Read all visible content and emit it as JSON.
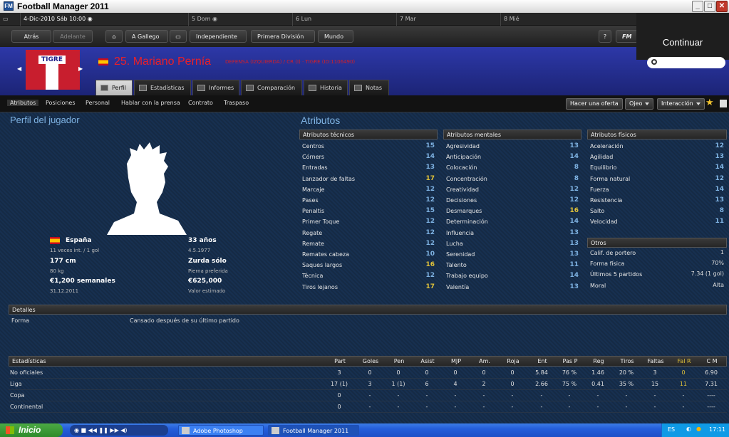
{
  "window": {
    "title": "Football Manager 2011",
    "icon_label": "FM"
  },
  "datebar": {
    "current": "4-Dic-2010 Sáb 10:00",
    "days": [
      "5 Dom",
      "6 Lun",
      "7 Mar",
      "8 Mié"
    ]
  },
  "nav": {
    "back": "Atrás",
    "forward": "Adelante",
    "club_menu": "A Gallego",
    "status_menu": "Independiente",
    "league_menu": "Primera División",
    "world_menu": "Mundo",
    "help": "?",
    "fm_menu": "FM",
    "continue": "Continuar"
  },
  "player": {
    "club_badge": "TIGRE",
    "name": "25. Mariano Pernía",
    "info": "DEFENSA (IZQUIERDA) / CR (I) · TIGRE (ID:1106490)",
    "nationality": "España",
    "caps": "11 veces int. / 1 gol",
    "age": "33 años",
    "dob": "4.5.1977",
    "height": "177 cm",
    "foot": "Zurda sólo",
    "weight": "80 kg",
    "foot_label": "Pierna preferida",
    "wage": "€1,200 semanales",
    "value": "€625,000",
    "contract_end": "31.12.2011",
    "value_label": "Valor estimado"
  },
  "tabs": [
    "Perfil",
    "Estadísticas",
    "Informes",
    "Comparación",
    "Historia",
    "Notas"
  ],
  "subtabs": [
    "Atributos",
    "Posiciones",
    "Personal",
    "Hablar con la prensa",
    "Contrato",
    "Traspaso"
  ],
  "actions": {
    "offer": "Hacer una oferta",
    "scout": "Ojeo",
    "interact": "Interacción"
  },
  "sections": {
    "profile": "Perfil del jugador",
    "attributes": "Atributos"
  },
  "technical": {
    "title": "Atributos técnicos",
    "items": [
      {
        "label": "Centros",
        "value": "15"
      },
      {
        "label": "Córners",
        "value": "14"
      },
      {
        "label": "Entradas",
        "value": "13"
      },
      {
        "label": "Lanzador de faltas",
        "value": "17"
      },
      {
        "label": "Marcaje",
        "value": "12"
      },
      {
        "label": "Pases",
        "value": "12"
      },
      {
        "label": "Penaltis",
        "value": "15"
      },
      {
        "label": "Primer Toque",
        "value": "12"
      },
      {
        "label": "Regate",
        "value": "12"
      },
      {
        "label": "Remate",
        "value": "12"
      },
      {
        "label": "Remates cabeza",
        "value": "10"
      },
      {
        "label": "Saques largos",
        "value": "16"
      },
      {
        "label": "Técnica",
        "value": "12"
      },
      {
        "label": "Tiros lejanos",
        "value": "17"
      }
    ]
  },
  "mental": {
    "title": "Atributos mentales",
    "items": [
      {
        "label": "Agresividad",
        "value": "13"
      },
      {
        "label": "Anticipación",
        "value": "14"
      },
      {
        "label": "Colocación",
        "value": "8"
      },
      {
        "label": "Concentración",
        "value": "8"
      },
      {
        "label": "Creatividad",
        "value": "12"
      },
      {
        "label": "Decisiones",
        "value": "12"
      },
      {
        "label": "Desmarques",
        "value": "16"
      },
      {
        "label": "Determinación",
        "value": "14"
      },
      {
        "label": "Influencia",
        "value": "13"
      },
      {
        "label": "Lucha",
        "value": "13"
      },
      {
        "label": "Serenidad",
        "value": "13"
      },
      {
        "label": "Talento",
        "value": "11"
      },
      {
        "label": "Trabajo equipo",
        "value": "14"
      },
      {
        "label": "Valentía",
        "value": "13"
      }
    ]
  },
  "physical": {
    "title": "Atributos físicos",
    "items": [
      {
        "label": "Aceleración",
        "value": "12"
      },
      {
        "label": "Agilidad",
        "value": "13"
      },
      {
        "label": "Equilibrio",
        "value": "14"
      },
      {
        "label": "Forma natural",
        "value": "12"
      },
      {
        "label": "Fuerza",
        "value": "14"
      },
      {
        "label": "Resistencia",
        "value": "13"
      },
      {
        "label": "Salto",
        "value": "8"
      },
      {
        "label": "Velocidad",
        "value": "11"
      }
    ]
  },
  "others": {
    "title": "Otros",
    "items": [
      {
        "label": "Calif. de portero",
        "value": "1"
      },
      {
        "label": "Forma física",
        "value": "70%"
      },
      {
        "label": "Últimos 5 partidos",
        "value": "7.34 (1 gol)"
      },
      {
        "label": "Moral",
        "value": "Alta"
      }
    ]
  },
  "details": {
    "title": "Detalles",
    "label": "Forma",
    "value": "Cansado después de su último partido"
  },
  "stats": {
    "title": "Estadísticas",
    "columns": [
      "Part",
      "Goles",
      "Pen",
      "Asist",
      "MJP",
      "Am.",
      "Roja",
      "Ent",
      "Pas P",
      "Reg",
      "Tiros",
      "Faltas",
      "Fal R",
      "C M"
    ],
    "rows": [
      {
        "name": "No oficiales",
        "cells": [
          "3",
          "0",
          "0",
          "0",
          "0",
          "0",
          "0",
          "5.84",
          "76 %",
          "1.46",
          "20 %",
          "3",
          "0",
          "6.90"
        ]
      },
      {
        "name": "Liga",
        "cells": [
          "17 (1)",
          "3",
          "1 (1)",
          "6",
          "4",
          "2",
          "0",
          "2.66",
          "75 %",
          "0.41",
          "35 %",
          "15",
          "11",
          "7.31"
        ]
      },
      {
        "name": "Copa",
        "cells": [
          "0",
          "-",
          "-",
          "-",
          "-",
          "-",
          "-",
          "-",
          "-",
          "-",
          "-",
          "-",
          "-",
          "----"
        ]
      },
      {
        "name": "Continental",
        "cells": [
          "0",
          "-",
          "-",
          "-",
          "-",
          "-",
          "-",
          "-",
          "-",
          "-",
          "-",
          "-",
          "-",
          "----"
        ]
      }
    ]
  },
  "taskbar": {
    "start": "Inicio",
    "tasks": [
      "Adobe Photoshop",
      "Football Manager 2011"
    ],
    "lang": "ES",
    "clock": "17:11"
  }
}
